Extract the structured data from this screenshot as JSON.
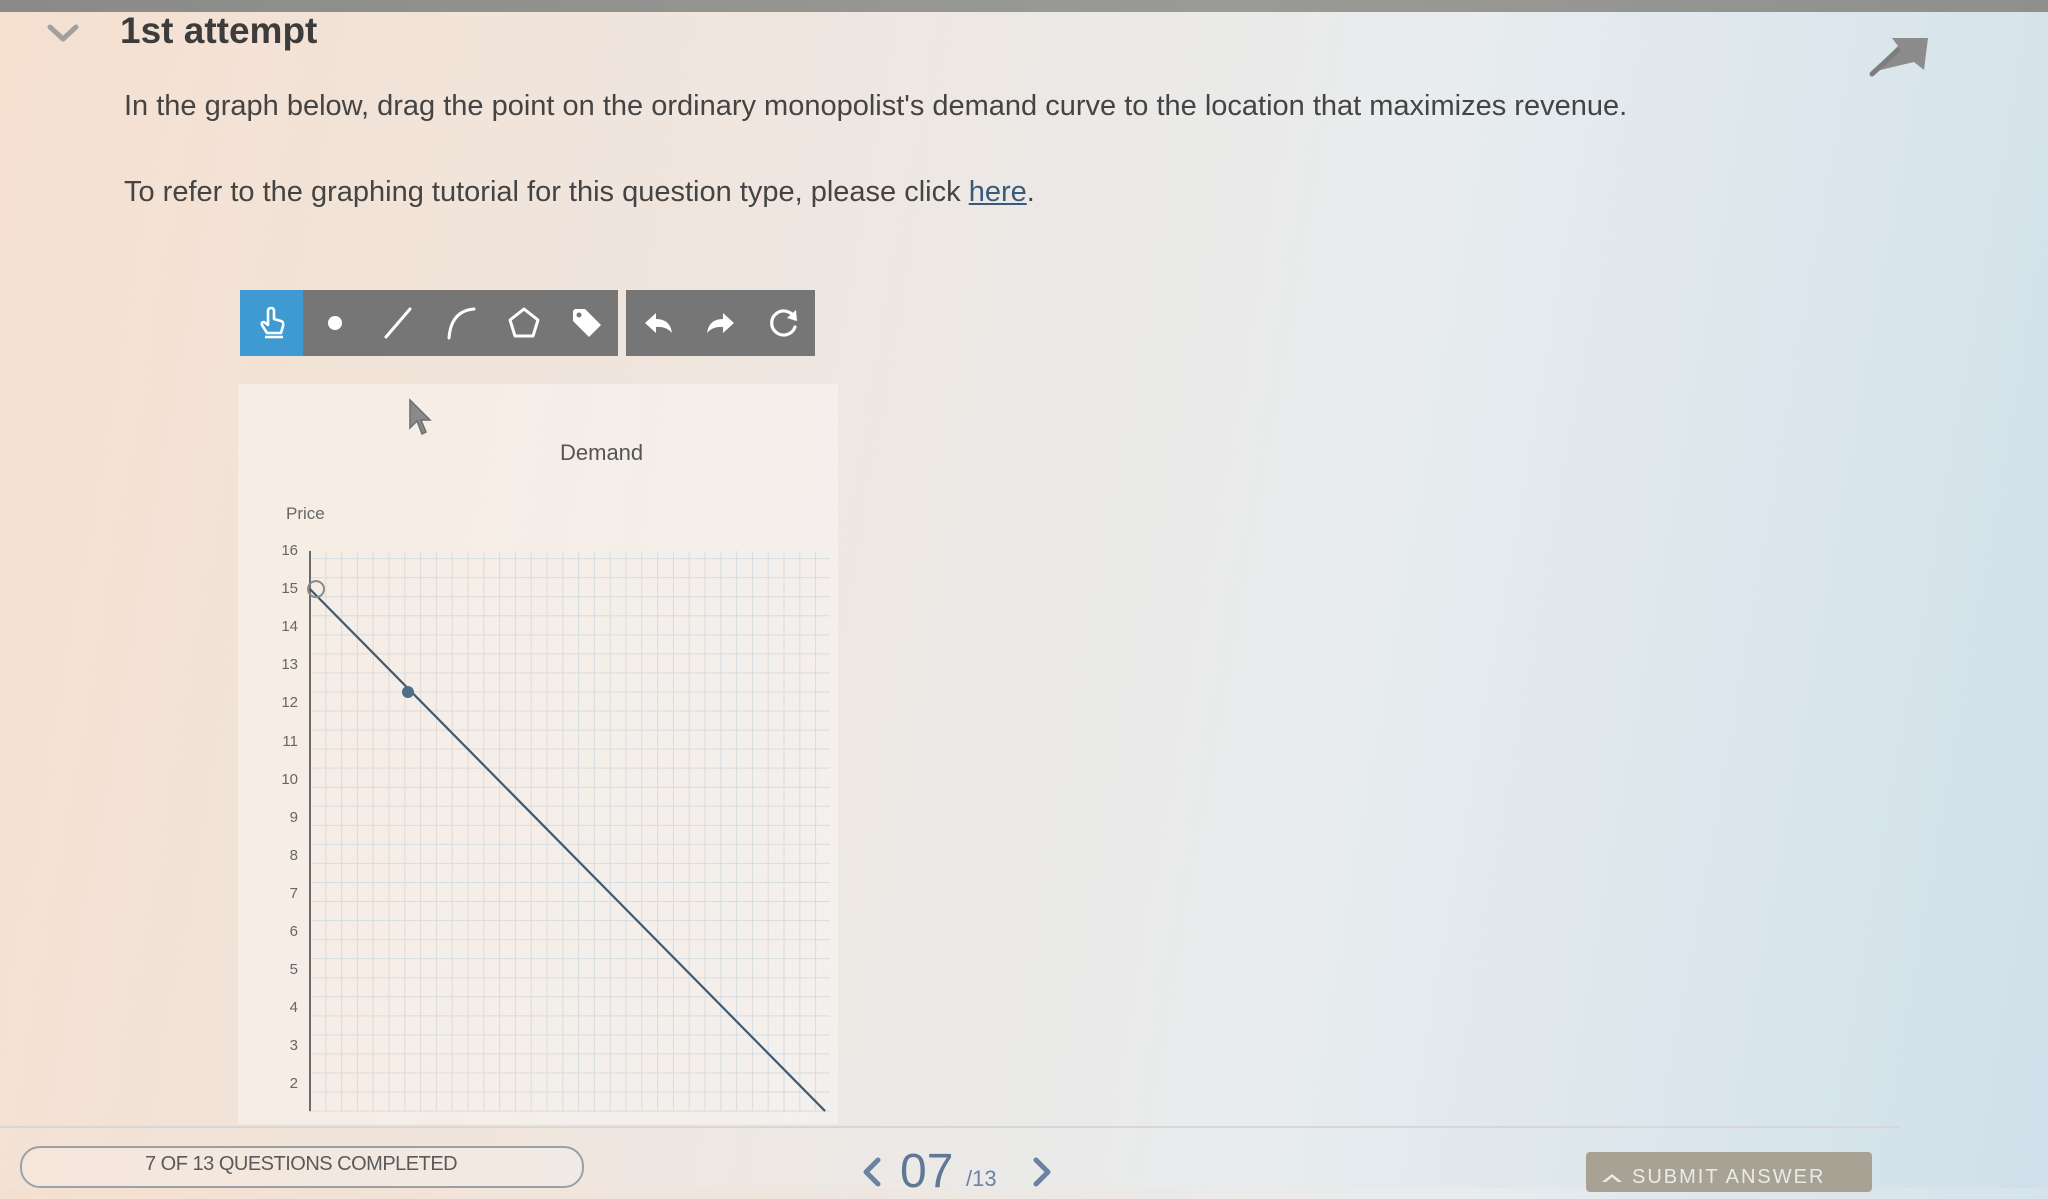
{
  "attempt": {
    "title": "1st attempt"
  },
  "question": {
    "instruction": "In the graph below, drag the point on the ordinary monopolist's demand curve to the location that maximizes revenue.",
    "tutorial_prefix": "To refer to the graphing tutorial for this question type, please click ",
    "tutorial_link": "here",
    "tutorial_suffix": "."
  },
  "toolbar": {
    "draw_tools": [
      "hand-icon",
      "point-icon",
      "line-icon",
      "curve-icon",
      "polygon-icon",
      "label-tag-icon"
    ],
    "history_tools": [
      "undo-icon",
      "redo-icon",
      "reset-icon"
    ],
    "active_tool": "hand-icon"
  },
  "graph": {
    "title": "Demand",
    "y_label": "Price",
    "y_ticks": [
      "16",
      "15",
      "14",
      "13",
      "12",
      "11",
      "10",
      "9",
      "8",
      "7",
      "6",
      "5",
      "4",
      "3",
      "2"
    ]
  },
  "chart_data": {
    "type": "line",
    "title": "Demand",
    "ylabel": "Price",
    "xlabel": "",
    "ylim": [
      1.3,
      16
    ],
    "grid": true,
    "series": [
      {
        "name": "Demand",
        "points": [
          [
            0,
            15
          ],
          [
            16.3,
            1.3
          ]
        ]
      }
    ],
    "draggable_point": [
      3.1,
      12.3
    ]
  },
  "footer": {
    "progress": "7 OF 13 QUESTIONS COMPLETED",
    "page_current": "07",
    "page_total": "/13",
    "submit_label": "SUBMIT ANSWER"
  },
  "colors": {
    "active_tool": "#3e9ad1",
    "toolbar": "#767676",
    "curve": "#3f5a70",
    "page_number": "#5f7896"
  }
}
